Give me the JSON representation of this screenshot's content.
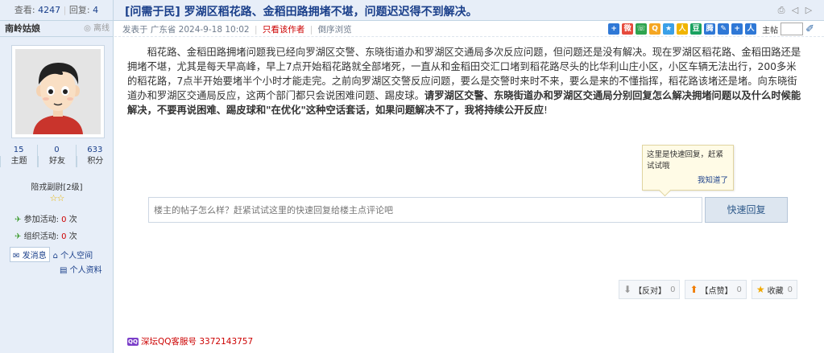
{
  "thread": {
    "views_label": "查看:",
    "views": "4247",
    "replies_label": "回复:",
    "replies": "4",
    "title": "[问需于民] 罗湖区稻花路、金稻田路拥堵不堪，问题迟迟得不到解决。"
  },
  "author": {
    "name": "南岭姑娘",
    "status": "离线",
    "stats": [
      {
        "value": "15",
        "label": "主题"
      },
      {
        "value": "0",
        "label": "好友"
      },
      {
        "value": "633",
        "label": "积分"
      }
    ],
    "rank": "陪戎副尉[2级]",
    "stars": "☆☆",
    "activity_join_label": "参加活动:",
    "activity_join_count": "0",
    "activity_org_label": "组织活动:",
    "activity_org_count": "0",
    "times_unit": "次",
    "send_message": "发消息",
    "personal_space": "个人空间",
    "personal_profile": "个人资料"
  },
  "post_meta": {
    "posted_at": "发表于 广东省 2024-9-18 10:02",
    "only_author": "只看该作者",
    "reverse": "倒序浏览",
    "floor_label": "主帖"
  },
  "share_colors": [
    "#2f78d6",
    "#e64a3c",
    "#2ea44f",
    "#f5a623",
    "#3aa0e8",
    "#f0b400",
    "#1aa260",
    "#2f78d6",
    "#2f78d6",
    "#2f78d6",
    "#2f78d6"
  ],
  "body": {
    "paragraph_normal": "稻花路、金稻田路拥堵问题我已经向罗湖区交警、东晓街道办和罗湖区交通局多次反应问题，但问题还是没有解决。现在罗湖区稻花路、金稻田路还是拥堵不堪，尤其是每天早高峰，早上7点开始稻花路就全部堵死，一直从和金稻田交汇口堵到稻花路尽头的比华利山庄小区，小区车辆无法出行，200多米的稻花路，7点半开始要堵半个小时才能走完。之前向罗湖区交警反应问题，要么是交警时来时不来，要么是来的不懂指挥，稻花路该堵还是堵。向东晓街道办和罗湖区交通局反应，这两个部门都只会说困难问题、踢皮球。",
    "paragraph_bold": "请罗湖区交警、东晓街道办和罗湖区交通局分别回复怎么解决拥堵问题以及什么时候能解决，不要再说困难、踢皮球和\"在优化\"这种空话套话，如果问题解决不了，我将持续公开反应",
    "paragraph_end": "!"
  },
  "tooltip": {
    "text": "这里是快速回复，赶紧试试哦",
    "dismiss": "我知道了"
  },
  "reply": {
    "placeholder": "楼主的帖子怎么样？赶紧试试这里的快速回复给楼主点评论吧",
    "button": "快速回复"
  },
  "votes": {
    "oppose_label": "【反对】",
    "oppose_count": "0",
    "like_label": "【点赞】",
    "like_count": "0",
    "fav_label": "收藏",
    "fav_count": "0"
  },
  "footer": {
    "badge": "QQ",
    "text": "深坛QQ客服号 3372143757"
  }
}
